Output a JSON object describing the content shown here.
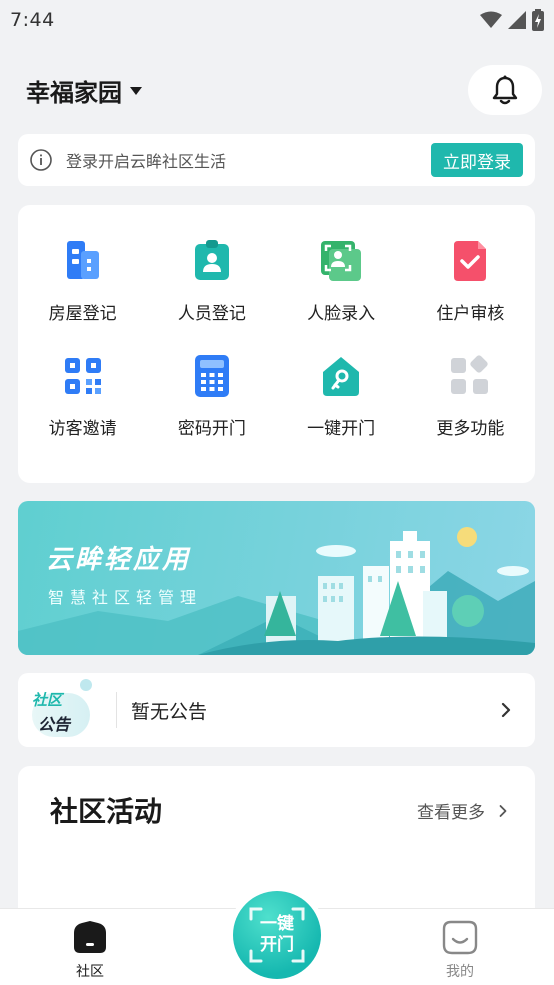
{
  "status_bar": {
    "time": "7:44"
  },
  "header": {
    "community_name": "幸福家园"
  },
  "login_bar": {
    "text": "登录开启云眸社区生活",
    "button": "立即登录"
  },
  "functions": [
    {
      "label": "房屋登记",
      "icon": "building-icon",
      "color": "#2f7cf6"
    },
    {
      "label": "人员登记",
      "icon": "person-badge-icon",
      "color": "#1fb8ad"
    },
    {
      "label": "人脸录入",
      "icon": "face-scan-icon",
      "color": "#34b36b"
    },
    {
      "label": "住户审核",
      "icon": "check-doc-icon",
      "color": "#f5506b"
    },
    {
      "label": "访客邀请",
      "icon": "qr-code-icon",
      "color": "#2f7cf6"
    },
    {
      "label": "密码开门",
      "icon": "keypad-icon",
      "color": "#2f7cf6"
    },
    {
      "label": "一键开门",
      "icon": "key-house-icon",
      "color": "#1fb8ad"
    },
    {
      "label": "更多功能",
      "icon": "more-grid-icon",
      "color": "#d0d3d8"
    }
  ],
  "banner": {
    "title": "云眸轻应用",
    "subtitle": "智慧社区轻管理"
  },
  "notice": {
    "badge_line1": "社区",
    "badge_line2": "公告",
    "text": "暂无公告"
  },
  "activity": {
    "title": "社区活动",
    "more": "查看更多"
  },
  "tabbar": {
    "home": "社区",
    "center_line1": "一键",
    "center_line2": "开门",
    "mine": "我的"
  }
}
